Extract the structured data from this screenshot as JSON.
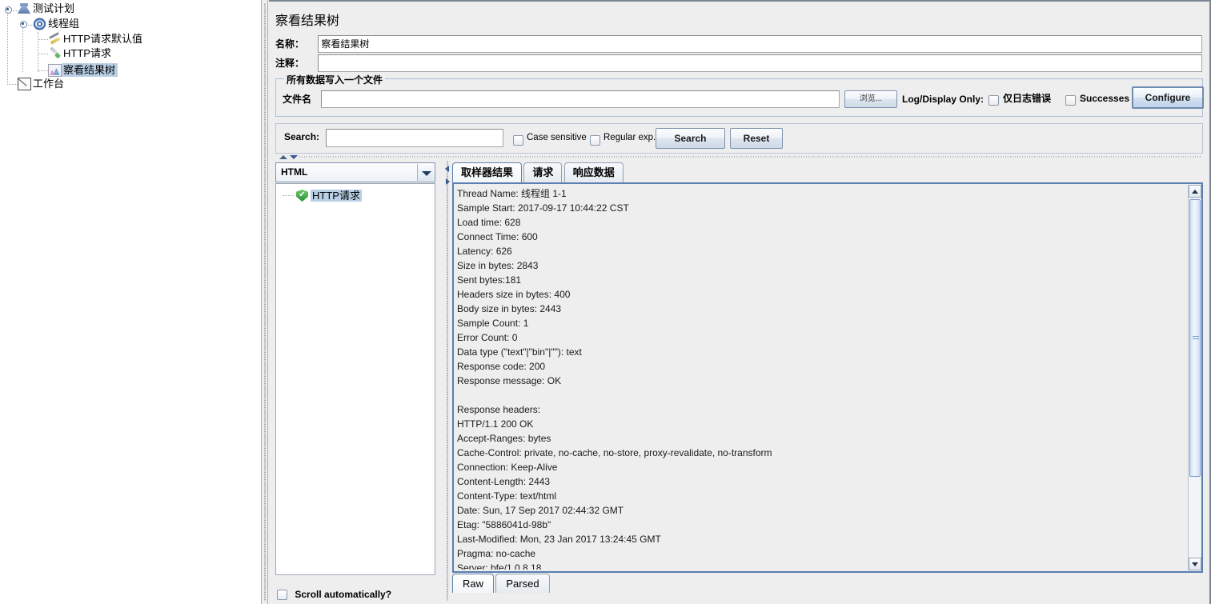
{
  "tree": {
    "nodes": [
      {
        "label": "测试计划",
        "icon": "flask-icon",
        "depth": 0,
        "selected": false
      },
      {
        "label": "线程组",
        "icon": "gear-icon",
        "depth": 1,
        "selected": false
      },
      {
        "label": "HTTP请求默认值",
        "icon": "wrench-icon",
        "depth": 2,
        "selected": false
      },
      {
        "label": "HTTP请求",
        "icon": "pencil-icon",
        "depth": 2,
        "selected": false
      },
      {
        "label": "察看结果树",
        "icon": "chart-icon",
        "depth": 2,
        "selected": true
      },
      {
        "label": "工作台",
        "icon": "notepad-icon",
        "depth": 0,
        "selected": false
      }
    ]
  },
  "main": {
    "title": "察看结果树",
    "name_label": "名称：",
    "name_value": "察看结果树",
    "comment_label": "注释：",
    "comment_value": "",
    "file_group": {
      "title": "所有数据写入一个文件",
      "filename_label": "文件名",
      "filename_value": "",
      "browse_label": "浏览...",
      "log_display_label": "Log/Display Only:",
      "errors_only_label": "仅日志错误",
      "errors_only_checked": false,
      "successes_label": "Successes",
      "successes_checked": false,
      "configure_label": "Configure"
    },
    "search": {
      "label": "Search:",
      "value": "",
      "case_sensitive_label": "Case sensitive",
      "case_sensitive_checked": false,
      "regular_exp_label": "Regular exp.",
      "regular_exp_checked": false,
      "search_button": "Search",
      "reset_button": "Reset"
    }
  },
  "results": {
    "renderer_selected": "HTML",
    "renderer_options": [
      "HTML"
    ],
    "sampler_label": "HTTP请求",
    "sampler_status": "success",
    "scroll_auto_label": "Scroll automatically?",
    "scroll_auto_checked": false
  },
  "tabs": {
    "items": [
      "取样器结果",
      "请求",
      "响应数据"
    ],
    "active_index": 0
  },
  "bottom_tabs": {
    "items": [
      "Raw",
      "Parsed"
    ],
    "active_index": 0
  },
  "response": {
    "text": "Thread Name: 线程组 1-1\nSample Start: 2017-09-17 10:44:22 CST\nLoad time: 628\nConnect Time: 600\nLatency: 626\nSize in bytes: 2843\nSent bytes:181\nHeaders size in bytes: 400\nBody size in bytes: 2443\nSample Count: 1\nError Count: 0\nData type (\"text\"|\"bin\"|\"\"): text\nResponse code: 200\nResponse message: OK\n\nResponse headers:\nHTTP/1.1 200 OK\nAccept-Ranges: bytes\nCache-Control: private, no-cache, no-store, proxy-revalidate, no-transform\nConnection: Keep-Alive\nContent-Length: 2443\nContent-Type: text/html\nDate: Sun, 17 Sep 2017 02:44:32 GMT\nEtag: \"5886041d-98b\"\nLast-Modified: Mon, 23 Jan 2017 13:24:45 GMT\nPragma: no-cache\nServer: bfe/1.0.8.18"
  },
  "colors": {
    "selection_blue": "#b8cfe5",
    "panel_gray": "#eeeeee",
    "border_blue": "#5b7fb0",
    "success_green": "#2b8f34"
  }
}
